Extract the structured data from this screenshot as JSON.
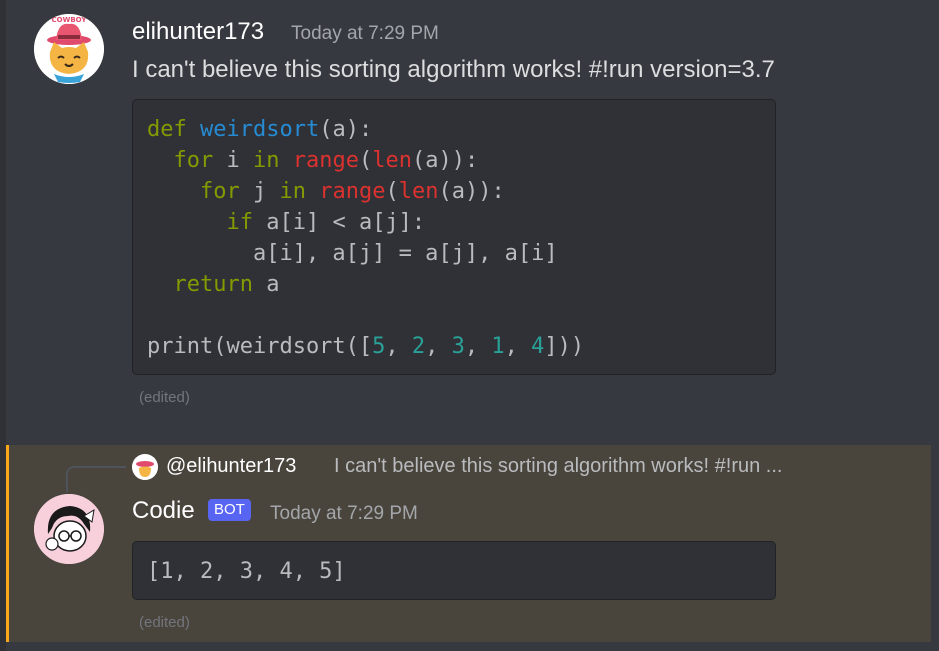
{
  "messages": [
    {
      "author": "elihunter173",
      "timestamp": "Today at 7:29 PM",
      "text": "I can't believe this sorting algorithm works! #!run version=3.7",
      "edited": "(edited)",
      "avatar_icon": "cowboy-cat-avatar-icon"
    },
    {
      "author": "Codie",
      "badge": "BOT",
      "timestamp": "Today at 7:29 PM",
      "reply_to": {
        "author": "@elihunter173",
        "text": "I can't believe this sorting algorithm works! #!run ..."
      },
      "output": "[1, 2, 3, 4, 5]",
      "edited": "(edited)",
      "avatar_icon": "anime-girl-avatar-icon"
    }
  ],
  "code": {
    "lines": [
      [
        {
          "t": "def ",
          "c": "kw"
        },
        {
          "t": "weirdsort",
          "c": "fn"
        },
        {
          "t": "(a):",
          "c": ""
        }
      ],
      [
        {
          "t": "  ",
          "c": ""
        },
        {
          "t": "for",
          "c": "kw"
        },
        {
          "t": " i ",
          "c": ""
        },
        {
          "t": "in",
          "c": "kw"
        },
        {
          "t": " ",
          "c": ""
        },
        {
          "t": "range",
          "c": "bi"
        },
        {
          "t": "(",
          "c": ""
        },
        {
          "t": "len",
          "c": "bi"
        },
        {
          "t": "(a)):",
          "c": ""
        }
      ],
      [
        {
          "t": "    ",
          "c": ""
        },
        {
          "t": "for",
          "c": "kw"
        },
        {
          "t": " j ",
          "c": ""
        },
        {
          "t": "in",
          "c": "kw"
        },
        {
          "t": " ",
          "c": ""
        },
        {
          "t": "range",
          "c": "bi"
        },
        {
          "t": "(",
          "c": ""
        },
        {
          "t": "len",
          "c": "bi"
        },
        {
          "t": "(a)):",
          "c": ""
        }
      ],
      [
        {
          "t": "      ",
          "c": ""
        },
        {
          "t": "if",
          "c": "kw"
        },
        {
          "t": " a[i] < a[j]:",
          "c": ""
        }
      ],
      [
        {
          "t": "        a[i], a[j] = a[j], a[i]",
          "c": ""
        }
      ],
      [
        {
          "t": "  ",
          "c": ""
        },
        {
          "t": "return",
          "c": "kw"
        },
        {
          "t": " a",
          "c": ""
        }
      ],
      [],
      [
        {
          "t": "print(weirdsort([",
          "c": ""
        },
        {
          "t": "5",
          "c": "num"
        },
        {
          "t": ", ",
          "c": ""
        },
        {
          "t": "2",
          "c": "num"
        },
        {
          "t": ", ",
          "c": ""
        },
        {
          "t": "3",
          "c": "num"
        },
        {
          "t": ", ",
          "c": ""
        },
        {
          "t": "1",
          "c": "num"
        },
        {
          "t": ", ",
          "c": ""
        },
        {
          "t": "4",
          "c": "num"
        },
        {
          "t": "]))",
          "c": ""
        }
      ]
    ]
  },
  "colors": {
    "background": "#36393f",
    "mention_highlight": "#49443c",
    "mention_bar": "#faa81a",
    "bot_badge": "#5865f2"
  }
}
